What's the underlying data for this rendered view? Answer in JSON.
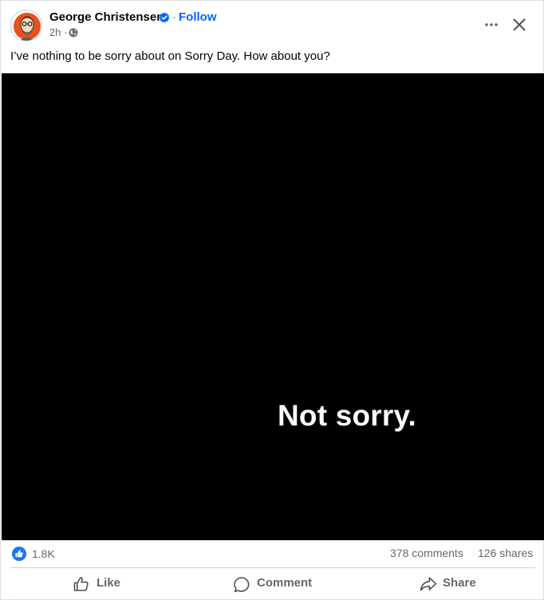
{
  "post": {
    "author": "George Christensen",
    "follow_label": "Follow",
    "separator": "·",
    "time": "2h",
    "time_separator": "·",
    "text": "I’ve nothing to be sorry about on Sorry Day. How about you?",
    "media_text": "Not sorry."
  },
  "icons": {
    "verified": "verified-badge-icon",
    "audience": "globe-icon",
    "more": "more-options-icon",
    "close": "close-icon",
    "reaction": "thumbs-up-reaction-icon",
    "like": "thumbs-up-icon",
    "comment": "comment-bubble-icon",
    "share": "share-arrow-icon"
  },
  "stats": {
    "reactions": "1.8K",
    "comments": "378 comments",
    "shares": "126 shares"
  },
  "actions": {
    "like": "Like",
    "comment": "Comment",
    "share": "Share"
  },
  "colors": {
    "accent": "#0866ff",
    "reaction_blue": "#1877f2",
    "secondary_text": "#65676b",
    "media_background": "#000000"
  }
}
